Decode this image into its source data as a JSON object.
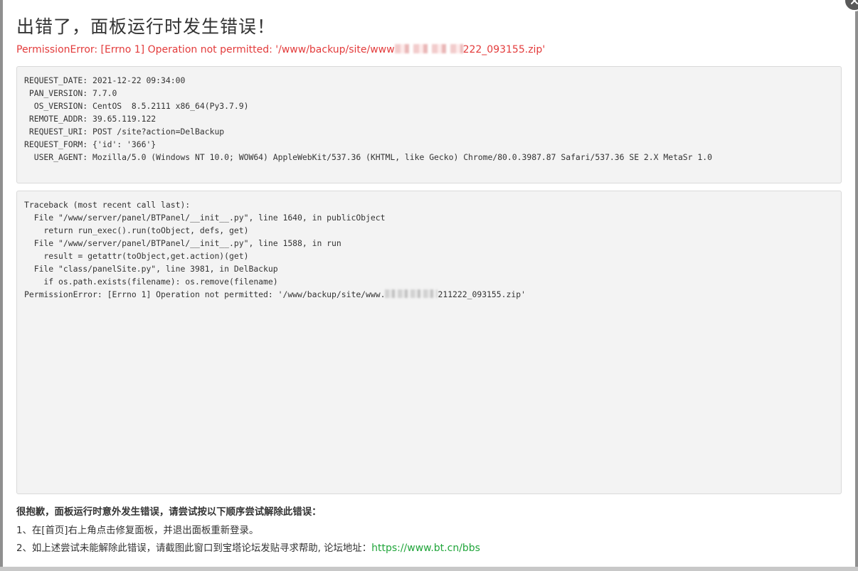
{
  "dialog": {
    "title": "出错了，面板运行时发生错误！",
    "error_message_prefix": "PermissionError: [Errno 1] Operation not permitted: '/www/backup/site/www",
    "error_message_suffix": "222_093155.zip'"
  },
  "request_info": [
    "REQUEST_DATE: 2021-12-22 09:34:00",
    " PAN_VERSION: 7.7.0",
    "  OS_VERSION: CentOS  8.5.2111 x86_64(Py3.7.9)",
    " REMOTE_ADDR: 39.65.119.122",
    " REQUEST_URI: POST /site?action=DelBackup",
    "REQUEST_FORM: {'id': '366'}",
    "  USER_AGENT: Mozilla/5.0 (Windows NT 10.0; WOW64) AppleWebKit/537.36 (KHTML, like Gecko) Chrome/80.0.3987.87 Safari/537.36 SE 2.X MetaSr 1.0"
  ],
  "traceback": [
    "Traceback (most recent call last):",
    "  File \"/www/server/panel/BTPanel/__init__.py\", line 1640, in publicObject",
    "    return run_exec().run(toObject, defs, get)",
    "  File \"/www/server/panel/BTPanel/__init__.py\", line 1588, in run",
    "    result = getattr(toObject,get.action)(get)",
    "  File \"class/panelSite.py\", line 3981, in DelBackup",
    "    if os.path.exists(filename): os.remove(filename)"
  ],
  "traceback_last_prefix": "PermissionError: [Errno 1] Operation not permitted: '/www/backup/site/www.",
  "traceback_last_suffix": "211222_093155.zip'",
  "help": {
    "heading": "很抱歉，面板运行时意外发生错误，请尝试按以下顺序尝试解除此错误：",
    "step1": "1、在[首页]右上角点击修复面板，并退出面板重新登录。",
    "step2_prefix": "2、如上述尝试未能解除此错误，请截图此窗口到宝塔论坛发贴寻求帮助, 论坛地址：",
    "forum_link": "https://www.bt.cn/bbs"
  },
  "colors": {
    "error_red": "#e33b3b",
    "link_green": "#20a53a"
  }
}
